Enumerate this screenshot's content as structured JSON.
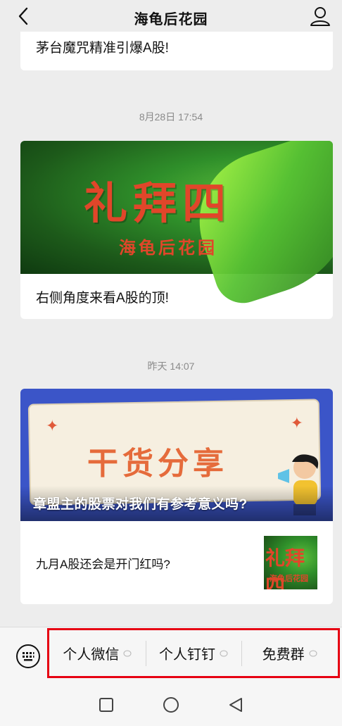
{
  "header": {
    "title": "海龟后花园",
    "back_icon": "chevron-left-icon",
    "profile_icon": "person-icon"
  },
  "feed": {
    "card1": {
      "title": "茅台魔咒精准引爆A股!"
    },
    "timestamp1": "8月28日 17:54",
    "card2": {
      "banner_text": "礼拜四",
      "banner_subtext": "海龟后花园",
      "title": "右侧角度来看A股的顶!"
    },
    "timestamp2": "昨天 14:07",
    "card3": {
      "banner_headline": "干货分享",
      "overlay_title": "章盟主的股票对我们有参考意义吗?",
      "item_title": "九月A股还会是开门红吗?",
      "thumb_text": "礼拜四",
      "thumb_subtext": "海龟后花园"
    }
  },
  "bottom_menu": {
    "keyboard_icon": "keyboard-icon",
    "items": [
      {
        "label": "个人微信"
      },
      {
        "label": "个人钉钉"
      },
      {
        "label": "免费群"
      }
    ],
    "highlight_color": "#e60012"
  },
  "system_nav": {
    "icons": [
      "square-icon",
      "circle-icon",
      "triangle-back-icon"
    ]
  }
}
